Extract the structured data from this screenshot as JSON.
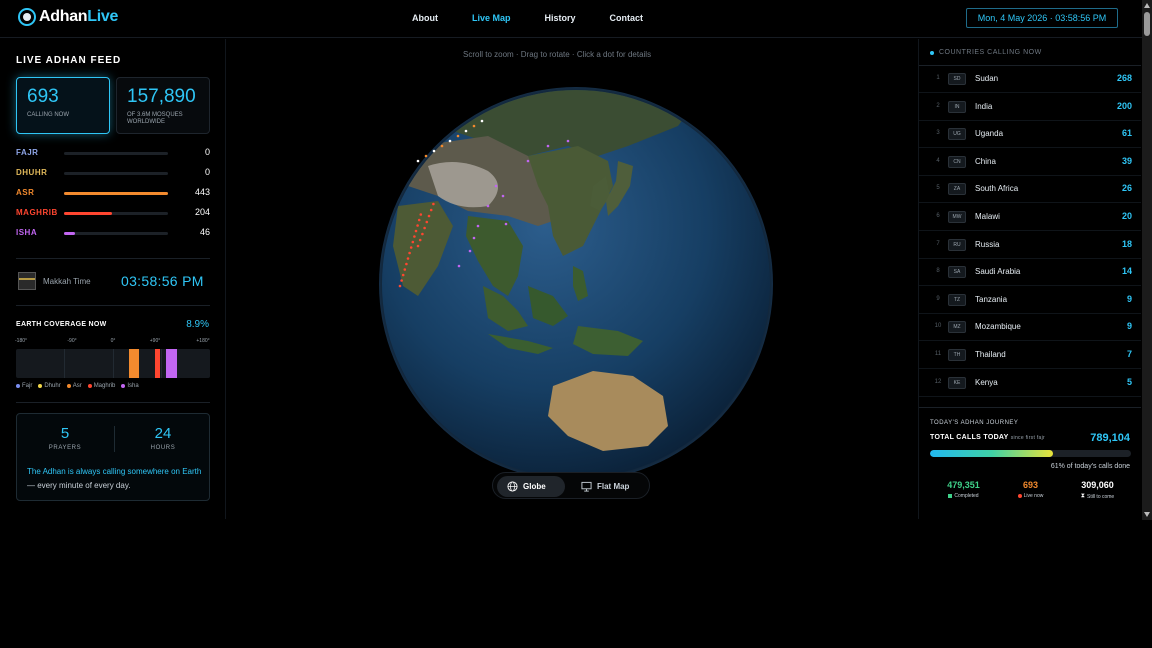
{
  "app": {
    "logo_main": "Adhan",
    "logo_accent": "Live",
    "datetime": "Mon, 4 May 2026 · 03:58:56 PM"
  },
  "nav": [
    {
      "label": "About",
      "active": false
    },
    {
      "label": "Live Map",
      "active": true
    },
    {
      "label": "History",
      "active": false
    },
    {
      "label": "Contact",
      "active": false
    }
  ],
  "feed": {
    "title": "LIVE ADHAN FEED",
    "calling_now": "693",
    "calling_now_label": "CALLING NOW",
    "mosques": "157,890",
    "mosques_label": "OF 3.6M MOSQUES WORLDWIDE",
    "prayers": [
      {
        "name": "FAJR",
        "count": "0",
        "fraction": 0,
        "color": "#8fa6e8"
      },
      {
        "name": "DHUHR",
        "count": "0",
        "fraction": 0,
        "color": "#e0b85a"
      },
      {
        "name": "ASR",
        "count": "443",
        "fraction": 1.0,
        "color": "#f28a2e"
      },
      {
        "name": "MAGHRIB",
        "count": "204",
        "fraction": 0.46,
        "color": "#ff4630"
      },
      {
        "name": "ISHA",
        "count": "46",
        "fraction": 0.11,
        "color": "#c266f2"
      }
    ],
    "makkah_label": "Makkah Time",
    "makkah_time": "03:58:56 PM"
  },
  "coverage": {
    "title": "EARTH COVERAGE NOW",
    "percent": "8.9%",
    "ticks": [
      "-180°",
      "-90°",
      "0°",
      "+90°",
      "+180°"
    ],
    "legend": [
      {
        "label": "Fajr",
        "color": "#7a8ef0"
      },
      {
        "label": "Dhuhr",
        "color": "#f2d74a"
      },
      {
        "label": "Asr",
        "color": "#f28a2e"
      },
      {
        "label": "Maghrib",
        "color": "#ff4630"
      },
      {
        "label": "Isha",
        "color": "#c266f2"
      }
    ]
  },
  "info": {
    "prayers_num": "5",
    "prayers_label": "PRAYERS",
    "hours_num": "24",
    "hours_label": "HOURS",
    "text_highlight": "The Adhan is always calling somewhere on Earth",
    "text_rest": " — every minute of every day."
  },
  "globe": {
    "hint": "Scroll to zoom · Drag to rotate · Click a dot for details",
    "globe_label": "Globe",
    "flat_label": "Flat Map"
  },
  "countries": {
    "title": "COUNTRIES CALLING NOW",
    "rows": [
      {
        "rank": "1",
        "code": "SD",
        "name": "Sudan",
        "count": "268"
      },
      {
        "rank": "2",
        "code": "IN",
        "name": "India",
        "count": "200"
      },
      {
        "rank": "3",
        "code": "UG",
        "name": "Uganda",
        "count": "61"
      },
      {
        "rank": "4",
        "code": "CN",
        "name": "China",
        "count": "39"
      },
      {
        "rank": "5",
        "code": "ZA",
        "name": "South Africa",
        "count": "26"
      },
      {
        "rank": "6",
        "code": "MW",
        "name": "Malawi",
        "count": "20"
      },
      {
        "rank": "7",
        "code": "RU",
        "name": "Russia",
        "count": "18"
      },
      {
        "rank": "8",
        "code": "SA",
        "name": "Saudi Arabia",
        "count": "14"
      },
      {
        "rank": "9",
        "code": "TZ",
        "name": "Tanzania",
        "count": "9"
      },
      {
        "rank": "10",
        "code": "MZ",
        "name": "Mozambique",
        "count": "9"
      },
      {
        "rank": "11",
        "code": "TH",
        "name": "Thailand",
        "count": "7"
      },
      {
        "rank": "12",
        "code": "KE",
        "name": "Kenya",
        "count": "5"
      }
    ]
  },
  "journey": {
    "title": "TODAY'S ADHAN JOURNEY",
    "total_label": "TOTAL CALLS TODAY",
    "total_sub": "since first fajr",
    "total": "789,104",
    "progress": 0.61,
    "progress_text": "61% of today's calls done",
    "completed": "479,351",
    "completed_label": "Completed",
    "live": "693",
    "live_label": "Live now",
    "remaining": "309,060",
    "remaining_label": "Still to come"
  }
}
